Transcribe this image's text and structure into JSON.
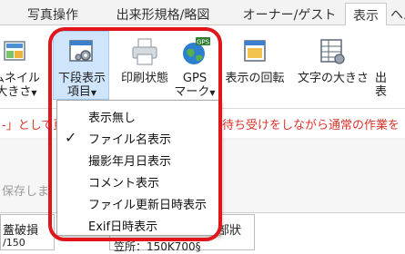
{
  "tabs": [
    {
      "label": "写真操作",
      "active": false
    },
    {
      "label": "出来形規格/略図",
      "active": false
    },
    {
      "label": "オーナー/ゲスト",
      "active": false
    },
    {
      "label": "表示",
      "active": true
    },
    {
      "label": "ヘルプ",
      "active": false
    }
  ],
  "ribbon": {
    "buttons": [
      {
        "name": "thumbnail",
        "line1": "ムネイル",
        "line2": "大きさ"
      },
      {
        "name": "lower-display",
        "line1": "下段表示",
        "line2": "項目"
      },
      {
        "name": "print-state",
        "line1": "印刷状態",
        "line2": ""
      },
      {
        "name": "gps-mark",
        "line1": "GPS",
        "line2": "マーク"
      },
      {
        "name": "display-rotation",
        "line1": "表示の回転",
        "line2": ""
      },
      {
        "name": "font-size",
        "line1": "文字の大きさ",
        "line2": ""
      },
      {
        "name": "output",
        "line1": "出",
        "line2": "表"
      }
    ],
    "gps_badge": "GPS"
  },
  "document": {
    "row1_left": "-」として頁",
    "row1_right": "待ち受けをしながら通常の作業を",
    "row2_text": "保存しま",
    "bottom_left_line1": "蓋破損",
    "bottom_left_line2": "/150",
    "bottom_mid": "笠所：150K700§",
    "bottom_right": "部狀"
  },
  "dropdown": {
    "items": [
      {
        "label": "表示無し",
        "checked": false
      },
      {
        "label": "ファイル名表示",
        "checked": true
      },
      {
        "label": "撮影年月日表示",
        "checked": false
      },
      {
        "label": "コメント表示",
        "checked": false
      },
      {
        "label": "ファイル更新日時表示",
        "checked": false
      },
      {
        "label": "Exif日時表示",
        "checked": false
      }
    ],
    "check_glyph": "✓"
  },
  "colors": {
    "highlight_ring": "#e0161b",
    "selected_button": "#cfe5fb",
    "warning_text": "#d8342b"
  }
}
